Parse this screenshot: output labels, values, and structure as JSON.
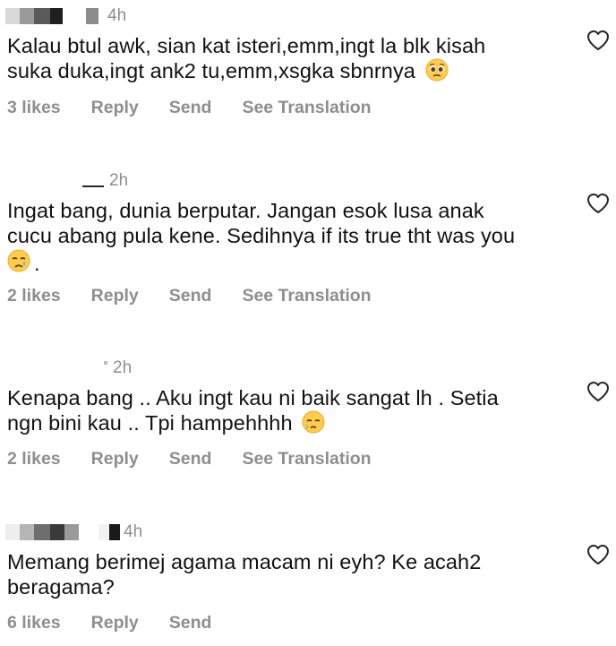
{
  "comments": [
    {
      "time": "4h",
      "text": "Kalau btul awk, sian kat isteri,emm,ingt la blk kisah\nsuka duka,ingt ank2 tu,emm,xsgka sbnrnya",
      "emoji": "pleading-face",
      "likes": "3 likes",
      "reply": "Reply",
      "send": "Send",
      "translate": "See Translation"
    },
    {
      "time": "2h",
      "text": "Ingat bang, dunia berputar. Jangan esok lusa anak\ncucu abang pula kene. Sedihnya if its true tht was you",
      "emoji": "crying-face",
      "trailing": ".",
      "likes": "2 likes",
      "reply": "Reply",
      "send": "Send",
      "translate": "See Translation"
    },
    {
      "time": "2h",
      "text": "Kenapa bang .. Aku ingt kau ni baik sangat lh . Setia\nngn bini kau .. Tpi hampehhhh",
      "emoji": "face-holding-back-tears",
      "likes": "2 likes",
      "reply": "Reply",
      "send": "Send",
      "translate": "See Translation"
    },
    {
      "time": "4h",
      "text": "Memang berimej agama macam ni eyh? Ke acah2\nberagama?",
      "likes": "6 likes",
      "reply": "Reply",
      "send": "Send"
    }
  ],
  "icons": {
    "like": "heart-outline-icon"
  },
  "colors": {
    "text": "#111111",
    "muted": "#8e8e8e",
    "emoji_face": "#ffcc4d"
  }
}
